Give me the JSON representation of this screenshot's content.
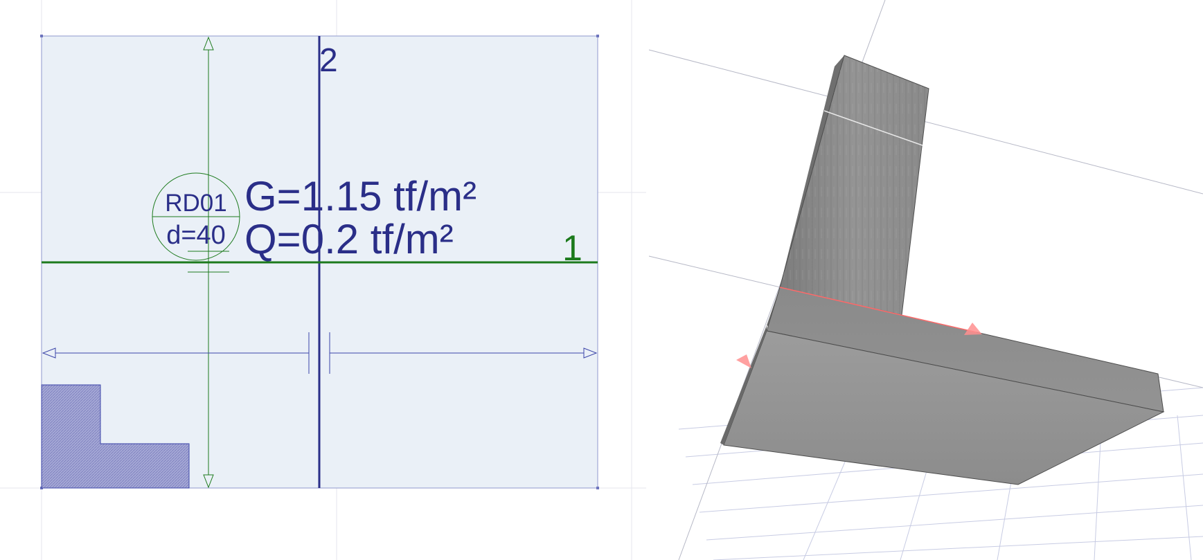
{
  "plan": {
    "slab_id": "RD01",
    "thickness_label": "d=40",
    "dead_load": "G=1.15 tf/m²",
    "live_load": "Q=0.2 tf/m²",
    "axis_1_label": "1",
    "axis_2_label": "2"
  },
  "colors": {
    "slab_fill": "#eaf0f7",
    "axis_blue": "#2a2e88",
    "axis_green": "#1c7a1c",
    "dim_blue": "#3b44a8",
    "section_hatch": "#9da0d0",
    "concrete": "#8e8e8e",
    "edge_red": "#ff6a6a"
  },
  "model": {
    "object": "L-shaped concrete wall",
    "material": "concrete"
  }
}
